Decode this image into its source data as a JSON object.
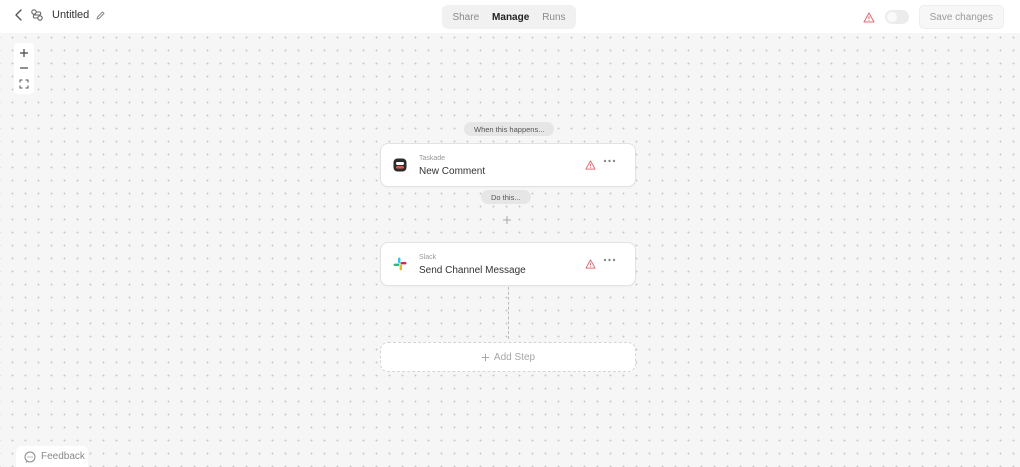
{
  "header": {
    "title": "Untitled",
    "tabs": [
      {
        "label": "Share",
        "active": false
      },
      {
        "label": "Manage",
        "active": true
      },
      {
        "label": "Runs",
        "active": false
      }
    ],
    "save_label": "Save changes",
    "enabled": false
  },
  "canvas": {
    "trigger_label": "When this happens...",
    "action_label": "Do this...",
    "steps": [
      {
        "app": "Taskade",
        "action": "New Comment",
        "icon": "taskade-icon"
      },
      {
        "app": "Slack",
        "action": "Send Channel Message",
        "icon": "slack-icon"
      }
    ],
    "add_step_label": "Add Step"
  },
  "feedback_label": "Feedback",
  "colors": {
    "warning": "#e0707a",
    "background": "#f6f6f6"
  }
}
